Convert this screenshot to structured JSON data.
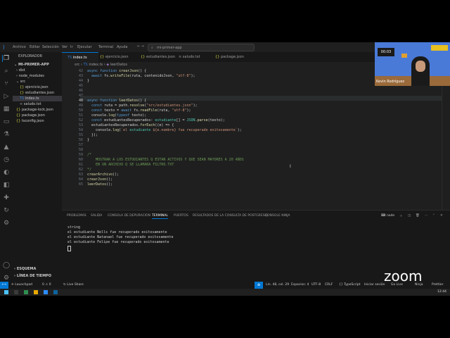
{
  "titlebar": {
    "menu": [
      "Archivo",
      "Editar",
      "Selección",
      "Ver",
      "Ir",
      "Ejecutar",
      "Terminal",
      "Ayuda"
    ],
    "search_text": "mi-primer-app"
  },
  "sidebar": {
    "header": "EXPLORADOR",
    "project": "MI-PRIMER-APP",
    "items": [
      {
        "label": "dist",
        "depth": 1,
        "type": "folder"
      },
      {
        "label": "node_modules",
        "depth": 1,
        "type": "folder"
      },
      {
        "label": "src",
        "depth": 1,
        "type": "folder-open"
      },
      {
        "label": "ejercicio.json",
        "depth": 2,
        "type": "json"
      },
      {
        "label": "estudiantes.json",
        "depth": 2,
        "type": "json"
      },
      {
        "label": "index.ts",
        "depth": 2,
        "type": "ts",
        "selected": true
      },
      {
        "label": "saludo.txt",
        "depth": 2,
        "type": "txt"
      },
      {
        "label": "package-lock.json",
        "depth": 1,
        "type": "json"
      },
      {
        "label": "package.json",
        "depth": 1,
        "type": "json"
      },
      {
        "label": "tsconfig.json",
        "depth": 1,
        "type": "json"
      }
    ],
    "outline": "ESQUEMA",
    "timeline": "LÍNEA DE TIEMPO"
  },
  "tabs": [
    {
      "label": "index.ts",
      "active": true
    },
    {
      "label": "ejercicio.json"
    },
    {
      "label": "estudiantes.json"
    },
    {
      "label": "saludo.txt"
    },
    {
      "label": "package.json"
    }
  ],
  "breadcrumb": [
    "src",
    "index.ts",
    "leerDatos"
  ],
  "code": {
    "line_numbers": [
      "42",
      "43",
      "44",
      "45",
      "46",
      "47",
      "48",
      "49",
      "50",
      "51",
      "52",
      "53",
      "54",
      "55",
      "56",
      "57",
      "58",
      "59",
      "60",
      "61",
      "62",
      "63",
      "64",
      "65"
    ],
    "lines": [
      "async function crearJson() {",
      "  await fs.writeFile(ruta, contenidoJson, \"utf-8\");",
      "}",
      "",
      "",
      "",
      "async function leerDatos() {",
      "  const ruta = path.resolve(\"src/estudiantes.json\");",
      "  const texto = await fs.readFile(ruta, \"utf-8\");",
      "  console.log(typeof texto);",
      "  const estudiantesRecuperados: estudiante[] = JSON.parse(texto);",
      "  estudiantesRecuperados.forEach((e) => {",
      "    console.log(`el estudiante ${e.nombre} fue recuperado exitosamente`);",
      "  });",
      "}",
      "",
      "",
      "/*",
      "    MOSTRAR A LOS ESTUDIANTES Q ESTAN ACTIVOS Y QUE SEAN MAYORES A 20 AÑOS",
      "    EN UN ARCHIVO Q SE LLAMARA FILTRO.TXT",
      "*/",
      "crearArchivo();",
      "crearJson();",
      "leerDatos();"
    ]
  },
  "panel": {
    "tabs": [
      "PROBLEMAS",
      "SALIDA",
      "CONSOLA DE DEPURACIÓN",
      "TERMINAL",
      "PUERTOS",
      "RESULTADOS DE LA CONSULTA DE POSTGRESQL",
      "CONSOLE NINJA"
    ],
    "shell": "node",
    "terminal_lines": [
      "string",
      "el estudiante Nells fue recuperado exitosamente",
      "el estudiante Natanael fue recuperado exitosamente",
      "el estudiante Felipe fue recuperado exitosamente"
    ]
  },
  "statusbar": {
    "left": [
      "Launchpad",
      "0 ⚠ 0",
      "Live Share"
    ],
    "right": [
      "Lín. 48, col. 29",
      "Espacios: 4",
      "UTF-8",
      "CRLF",
      "{} TypeScript",
      "Iniciar sesión",
      "Go Live",
      "Ninja",
      "Prettier"
    ]
  },
  "taskbar": {
    "time": "12:44"
  },
  "webcam": {
    "timer": "00:03",
    "name": "Kevin Rodríguez"
  },
  "zoom": {
    "logo": "zoom"
  },
  "colors": {
    "accent": "#0078d4",
    "activity_bg": "#181818",
    "editor_bg": "#1f1f1f"
  }
}
